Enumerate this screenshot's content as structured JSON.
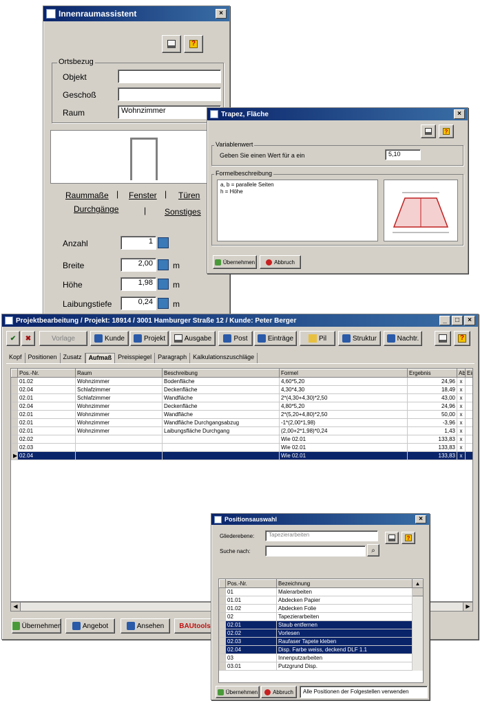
{
  "room_wizard": {
    "title": "Innenraumassistent",
    "close_label": "×",
    "group_location": "Ortsbezug",
    "fields": [
      {
        "label": "Objekt",
        "value": ""
      },
      {
        "label": "Geschoß",
        "value": ""
      },
      {
        "label": "Raum",
        "value": "Wohnzimmer"
      }
    ],
    "tabs_row1": [
      "Raummaße",
      "Fenster",
      "Türen"
    ],
    "tabs_row2": [
      "Durchgänge",
      "Sonstiges"
    ],
    "values": [
      {
        "label": "Anzahl",
        "value": "1",
        "unit": ""
      },
      {
        "label": "Breite",
        "value": "2,00",
        "unit": "m"
      },
      {
        "label": "Höhe",
        "value": "1,98",
        "unit": "m"
      },
      {
        "label": "Laibungstiefe",
        "value": "0,24",
        "unit": "m"
      }
    ]
  },
  "trapezoid_dialog": {
    "title": "Trapez, Fläche",
    "group_vars": "Variablenwert",
    "prompt": "Geben Sie einen Wert für a ein",
    "input_value": "5,10",
    "group_formula": "Formelbeschreibung",
    "formula_lines": [
      "a, b = parallele Seiten",
      "h    = Höhe"
    ],
    "btn_accept": "Übernehmen",
    "btn_cancel": "Abbruch"
  },
  "project_window": {
    "title": "Projektbearbeitung / Projekt: 18914 / 3001 Hamburger Straße 12 / Kunde: Peter Berger",
    "controls": [
      "_",
      "□",
      "×"
    ],
    "toolbar": [
      "Vorlage",
      "Kunde",
      "Projekt",
      "Ausgabe",
      "Post",
      "Einträge",
      "Pil",
      "Struktur",
      "Nachtr."
    ],
    "tabs": [
      "Kopf",
      "Positionen",
      "Zusatz",
      "Aufmaß",
      "Preisspiegel",
      "Paragraph",
      "Kalkulationszuschläge"
    ],
    "active_tab": "Aufmaß",
    "columns": [
      "Pos.-Nr.",
      "Raum",
      "Beschreibung",
      "Formel",
      "Ergebnis",
      "Abr.",
      "Ein"
    ],
    "rows": [
      [
        "01.02",
        "Wohnzimmer",
        "Bodenfläche",
        "4,60*5,20",
        "24,96",
        "x",
        ""
      ],
      [
        "02.04",
        "Schlafzimmer",
        "Deckenfläche",
        "4,30*4,30",
        "18,49",
        "x",
        ""
      ],
      [
        "02.01",
        "Schlafzimmer",
        "Wandfläche",
        "2*(4,30+4,30)*2,50",
        "43,00",
        "x",
        ""
      ],
      [
        "02.04",
        "Wohnzimmer",
        "Deckenfläche",
        "4,80*5,20",
        "24,96",
        "x",
        ""
      ],
      [
        "02.01",
        "Wohnzimmer",
        "Wandfläche",
        "2*(5,20+4,80)*2,50",
        "50,00",
        "x",
        ""
      ],
      [
        "02.01",
        "Wohnzimmer",
        "Wandfläche Durchgangsabzug",
        "-1*(2,00*1,98)",
        "-3,96",
        "x",
        ""
      ],
      [
        "02.01",
        "Wohnzimmer",
        "Laibungsfläche Durchgang",
        "(2,00+2*1,98)*0,24",
        "1,43",
        "x",
        ""
      ],
      [
        "02.02",
        "",
        "",
        "Wie 02.01",
        "133,83",
        "x",
        ""
      ],
      [
        "02.03",
        "",
        "",
        "Wie 02.01",
        "133,83",
        "x",
        ""
      ],
      [
        "02.04",
        "",
        "",
        "Wie 02.01",
        "133,83",
        "x",
        ""
      ]
    ],
    "bottom_buttons": [
      "Übernehmen",
      "Angebot",
      "Ansehen",
      "BAUtools"
    ]
  },
  "position_select": {
    "title": "Positionsauswahl",
    "label_struct": "Gliederebene:",
    "struct_value": "Tapezierarbeiten",
    "label_search": "Suche nach:",
    "search_value": "",
    "columns": [
      "Pos.-Nr.",
      "Bezeichnung"
    ],
    "rows": [
      [
        "01",
        "Malerarbeiten"
      ],
      [
        "01.01",
        "Abdecken Papier"
      ],
      [
        "01.02",
        "Abdecken Folie"
      ],
      [
        "02",
        "Tapezierarbeiten"
      ],
      [
        "02.01",
        "Staub entfernen"
      ],
      [
        "02.02",
        "Vorlesen"
      ],
      [
        "02.03",
        "Raufaser Tapete kleben"
      ],
      [
        "02.04",
        "Disp. Farbe weiss, deckend DLF 1.1"
      ],
      [
        "03",
        "Innenputzarbeiten"
      ],
      [
        "03.01",
        "Putzgrund Disp."
      ]
    ],
    "selected": [
      4,
      5,
      6,
      7
    ],
    "btn_accept": "Übernehmen",
    "btn_cancel": "Abbruch",
    "footer_text": "Alle Positionen der Folgestellen verwenden"
  }
}
